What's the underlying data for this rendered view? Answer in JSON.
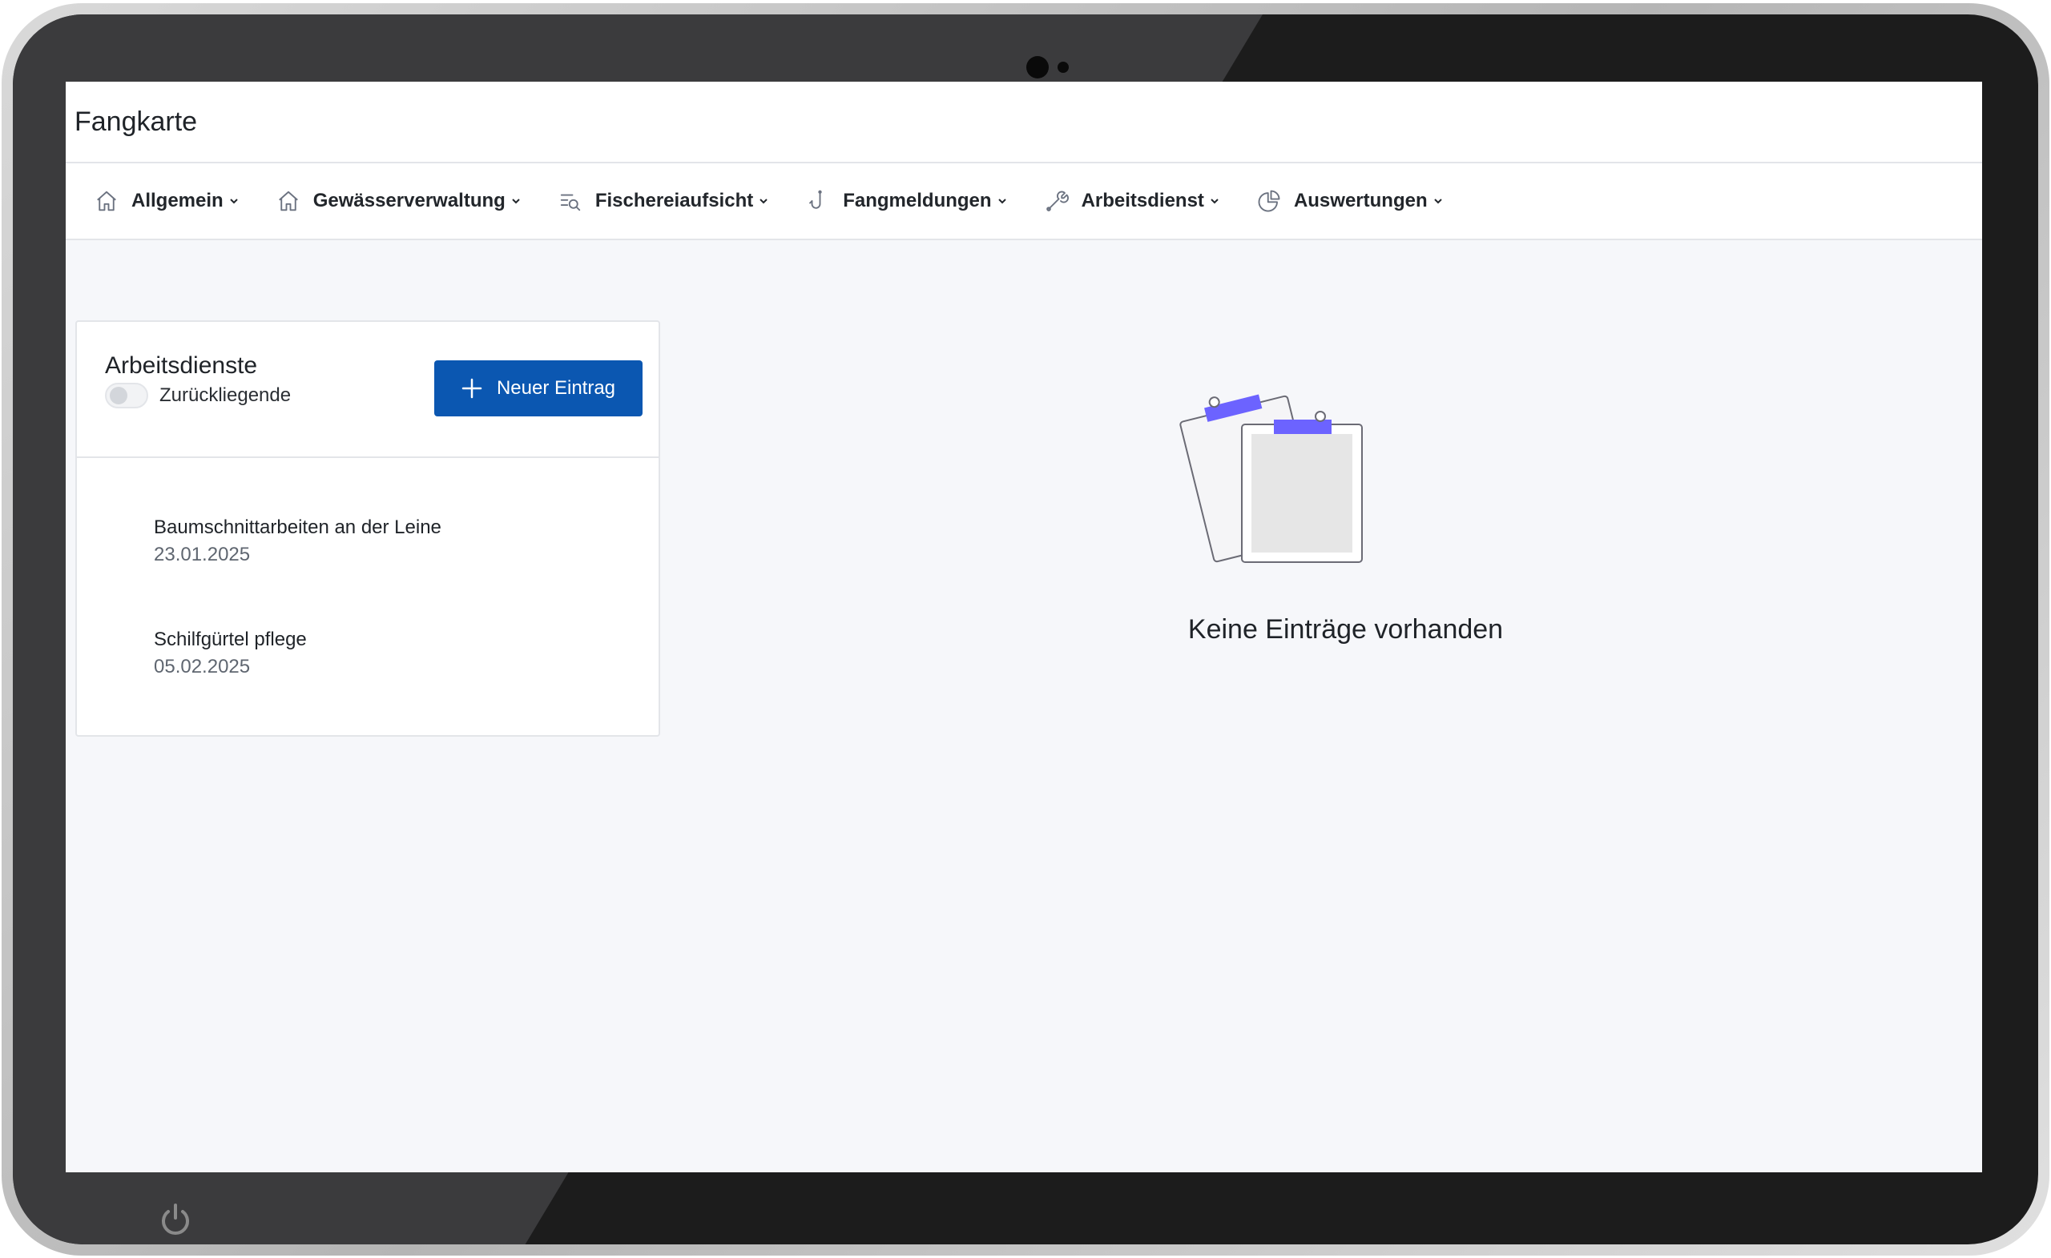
{
  "app": {
    "title": "Fangkarte"
  },
  "nav": {
    "items": [
      {
        "label": "Allgemein",
        "icon": "home-icon"
      },
      {
        "label": "Gewässerverwaltung",
        "icon": "home-icon"
      },
      {
        "label": "Fischereiaufsicht",
        "icon": "list-search-icon"
      },
      {
        "label": "Fangmeldungen",
        "icon": "fishing-hook-icon"
      },
      {
        "label": "Arbeitsdienst",
        "icon": "tool-icon"
      },
      {
        "label": "Auswertungen",
        "icon": "pie-chart-icon"
      }
    ]
  },
  "card": {
    "title": "Arbeitsdienste",
    "toggle_label": "Zurückliegende",
    "toggle_on": false,
    "new_button_label": "Neuer Eintrag",
    "entries": [
      {
        "title": "Baumschnittarbeiten an der Leine",
        "date": "23.01.2025"
      },
      {
        "title": "Schilfgürtel pflege",
        "date": "05.02.2025"
      }
    ]
  },
  "empty_state": {
    "text": "Keine Einträge vorhanden",
    "icon": "clipboards-illustration"
  },
  "colors": {
    "primary": "#0b57b1",
    "accent_clip": "#6c63ff",
    "background": "#f6f7fa"
  }
}
